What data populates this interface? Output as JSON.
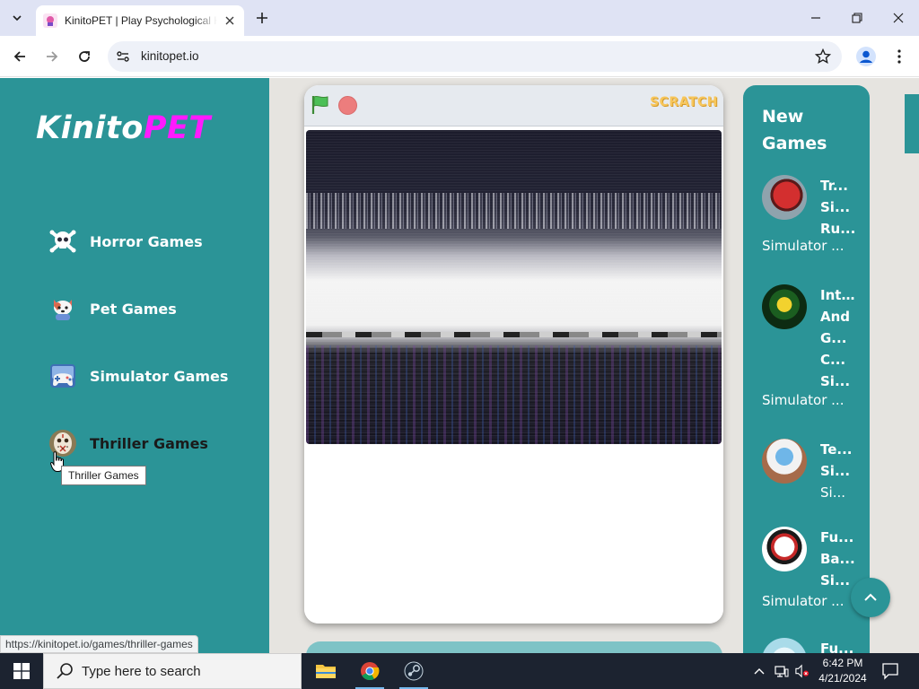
{
  "browser": {
    "tab_title": "KinitoPET | Play Psychological Horror Games",
    "url": "kinitopet.io",
    "status_url": "https://kinitopet.io/games/thriller-games"
  },
  "site": {
    "logo_part1": "Kinito",
    "logo_part2": "PET",
    "accent_color": "#2b9497",
    "logo_accent": "#ff1aff",
    "categories": [
      {
        "label": "Horror Games",
        "icon": "skull-icon"
      },
      {
        "label": "Pet Games",
        "icon": "pet-icon"
      },
      {
        "label": "Simulator Games",
        "icon": "gamepad-icon"
      },
      {
        "label": "Thriller Games",
        "icon": "mask-icon"
      }
    ],
    "tooltip": "Thriller Games"
  },
  "game": {
    "scratch_label": "SCRATCH"
  },
  "new_games": {
    "title": "New Games",
    "items": [
      {
        "name_lines": [
          "Tr...",
          "Si...",
          "Ru..."
        ],
        "category": "Simulator ..."
      },
      {
        "name_lines": [
          "Int...",
          "And",
          "G...",
          "C...",
          "Si..."
        ],
        "category": "Simulator ..."
      },
      {
        "name_lines": [
          "Te...",
          "Si...",
          "Si..."
        ],
        "category": ""
      },
      {
        "name_lines": [
          "Fu...",
          "Ba...",
          "Si..."
        ],
        "category": "Simulator ..."
      },
      {
        "name_lines": [
          "Fu..."
        ],
        "category": ""
      }
    ]
  },
  "taskbar": {
    "search_placeholder": "Type here to search",
    "time": "6:42 PM",
    "date": "4/21/2024"
  }
}
